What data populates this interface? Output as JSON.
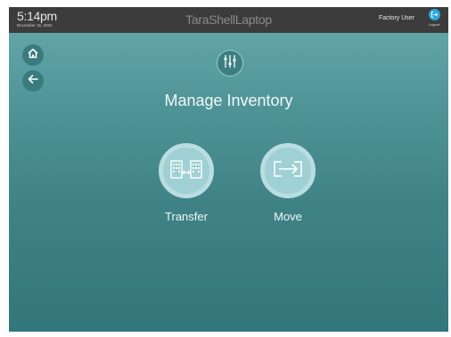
{
  "topbar": {
    "time": "5:14pm",
    "date": "December 15, 2022",
    "device_name": "TaraShellLaptop",
    "user": "Factory User",
    "logout_label": "Logout"
  },
  "icons": {
    "home": "home-icon",
    "back": "arrow-left-icon",
    "header": "sliders-icon",
    "transfer": "buildings-transfer-icon",
    "move": "arrow-box-icon",
    "logout": "logout-icon"
  },
  "main": {
    "title": "Manage Inventory",
    "actions": [
      {
        "label": "Transfer"
      },
      {
        "label": "Move"
      }
    ]
  },
  "colors": {
    "topbar": "#3c3c3c",
    "background_top": "#67aaae",
    "background_bottom": "#32777a",
    "action_circle": "#9fd0d3",
    "logout_accent": "#2ba6e0"
  }
}
